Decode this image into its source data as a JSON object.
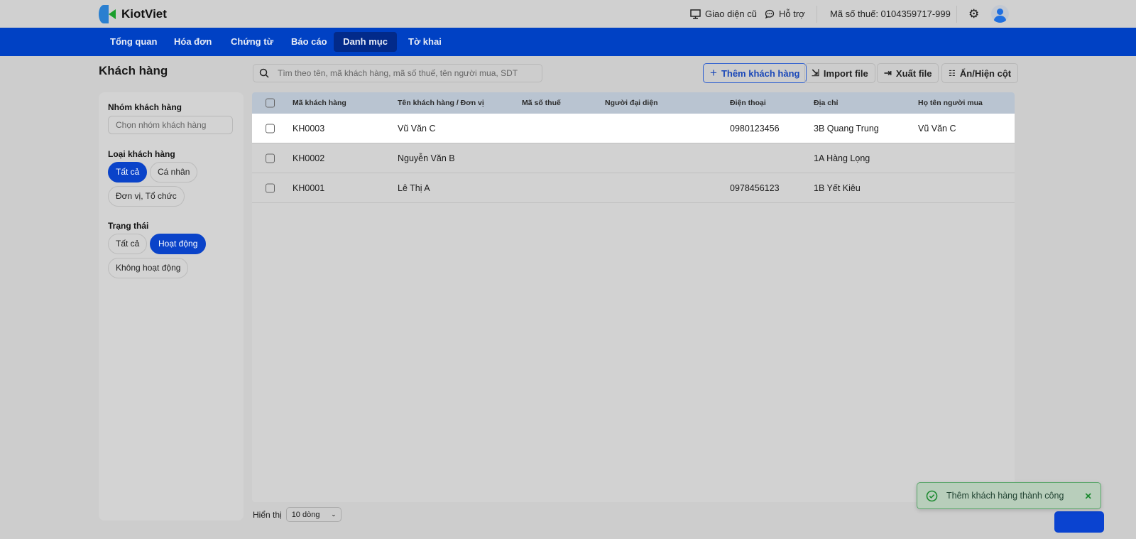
{
  "header": {
    "brand": "KiotViet",
    "old_ui": "Giao diện cũ",
    "support": "Hỗ trợ",
    "tax_code": "Mã số thuế: 0104359717-999"
  },
  "nav": {
    "items": [
      {
        "label": "Tổng quan"
      },
      {
        "label": "Hóa đơn"
      },
      {
        "label": "Chứng từ"
      },
      {
        "label": "Báo cáo"
      },
      {
        "label": "Danh mục",
        "active": true
      },
      {
        "label": "Tờ khai"
      }
    ]
  },
  "page": {
    "title": "Khách hàng",
    "search_placeholder": "Tìm theo tên, mã khách hàng, mã số thuế, tên người mua, SDT"
  },
  "toolbar": {
    "add": "Thêm khách hàng",
    "import": "Import file",
    "export": "Xuất file",
    "columns": "Ẩn/Hiện cột"
  },
  "filters": {
    "group_label": "Nhóm khách hàng",
    "group_placeholder": "Chọn nhóm khách hàng",
    "type_label": "Loại khách hàng",
    "type_options": [
      "Tất cả",
      "Cá nhân",
      "Đơn vị, Tổ chức"
    ],
    "status_label": "Trạng thái",
    "status_options": [
      "Tất cả",
      "Hoạt động",
      "Không hoạt động"
    ]
  },
  "table": {
    "columns": [
      "Mã khách hàng",
      "Tên khách hàng / Đơn vị",
      "Mã số thuế",
      "Người đại diện",
      "Điện thoại",
      "Địa chỉ",
      "Họ tên người mua"
    ],
    "rows": [
      [
        "KH0003",
        "Vũ Văn C",
        "",
        "",
        "0980123456",
        "3B Quang Trung",
        "Vũ Văn C"
      ],
      [
        "KH0002",
        "Nguyễn Văn B",
        "",
        "",
        "",
        "1A Hàng Lọng",
        ""
      ],
      [
        "KH0001",
        "Lê Thị A",
        "",
        "",
        "0978456123",
        "1B Yết Kiêu",
        ""
      ]
    ]
  },
  "footer": {
    "show_label": "Hiển thị",
    "page_size": "10 dòng"
  },
  "toast": {
    "message": "Thêm khách hàng thành công"
  },
  "colors": {
    "nav": "#0041c4",
    "accent": "#0a43c9",
    "success": "#1c8a30"
  }
}
